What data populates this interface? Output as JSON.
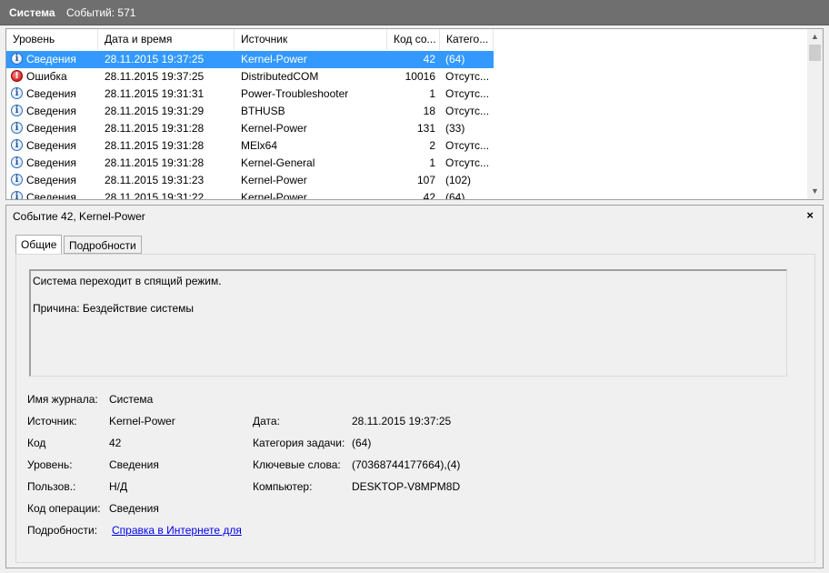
{
  "titlebar": {
    "name": "Система",
    "count_text": "Событий: 571"
  },
  "list": {
    "columns": [
      "Уровень",
      "Дата и время",
      "Источник",
      "Код со...",
      "Катего..."
    ],
    "rows": [
      {
        "icon": "info-icon",
        "level": "Сведения",
        "datetime": "28.11.2015 19:37:25",
        "source": "Kernel-Power",
        "code": "42",
        "category": "(64)",
        "selected": true
      },
      {
        "icon": "error-icon",
        "level": "Ошибка",
        "datetime": "28.11.2015 19:37:25",
        "source": "DistributedCOM",
        "code": "10016",
        "category": "Отсутс...",
        "selected": false
      },
      {
        "icon": "info-icon",
        "level": "Сведения",
        "datetime": "28.11.2015 19:31:31",
        "source": "Power-Troubleshooter",
        "code": "1",
        "category": "Отсутс...",
        "selected": false
      },
      {
        "icon": "info-icon",
        "level": "Сведения",
        "datetime": "28.11.2015 19:31:29",
        "source": "BTHUSB",
        "code": "18",
        "category": "Отсутс...",
        "selected": false
      },
      {
        "icon": "info-icon",
        "level": "Сведения",
        "datetime": "28.11.2015 19:31:28",
        "source": "Kernel-Power",
        "code": "131",
        "category": "(33)",
        "selected": false
      },
      {
        "icon": "info-icon",
        "level": "Сведения",
        "datetime": "28.11.2015 19:31:28",
        "source": "MElx64",
        "code": "2",
        "category": "Отсутс...",
        "selected": false
      },
      {
        "icon": "info-icon",
        "level": "Сведения",
        "datetime": "28.11.2015 19:31:28",
        "source": "Kernel-General",
        "code": "1",
        "category": "Отсутс...",
        "selected": false
      },
      {
        "icon": "info-icon",
        "level": "Сведения",
        "datetime": "28.11.2015 19:31:23",
        "source": "Kernel-Power",
        "code": "107",
        "category": "(102)",
        "selected": false
      },
      {
        "icon": "info-icon",
        "level": "Сведения",
        "datetime": "28.11.2015 19:31:22",
        "source": "Kernel-Power",
        "code": "42",
        "category": "(64)",
        "selected": false
      }
    ]
  },
  "detail": {
    "title": "Событие 42, Kernel-Power",
    "close": "×",
    "tabs": [
      "Общие",
      "Подробности"
    ],
    "message_line1": "Система переходит в спящий режим.",
    "message_line2": "Причина: Бездействие системы",
    "fields": {
      "log_label": "Имя журнала:",
      "log_value": "Система",
      "source_label": "Источник:",
      "source_value": "Kernel-Power",
      "date_label": "Дата:",
      "date_value": "28.11.2015 19:37:25",
      "code_label": "Код",
      "code_value": "42",
      "task_label": "Категория задачи:",
      "task_value": "(64)",
      "level_label": "Уровень:",
      "level_value": "Сведения",
      "keywords_label": "Ключевые слова:",
      "keywords_value": "(70368744177664),(4)",
      "user_label": "Пользов.:",
      "user_value": "Н/Д",
      "computer_label": "Компьютер:",
      "computer_value": "DESKTOP-V8MPM8D",
      "opcode_label": "Код операции:",
      "opcode_value": "Сведения",
      "more_label": "Подробности:",
      "more_link": "Справка в Интернете для "
    }
  },
  "colors": {
    "selection": "#3399ff",
    "titlebar": "#6f6f6f",
    "link": "#0000ee"
  }
}
